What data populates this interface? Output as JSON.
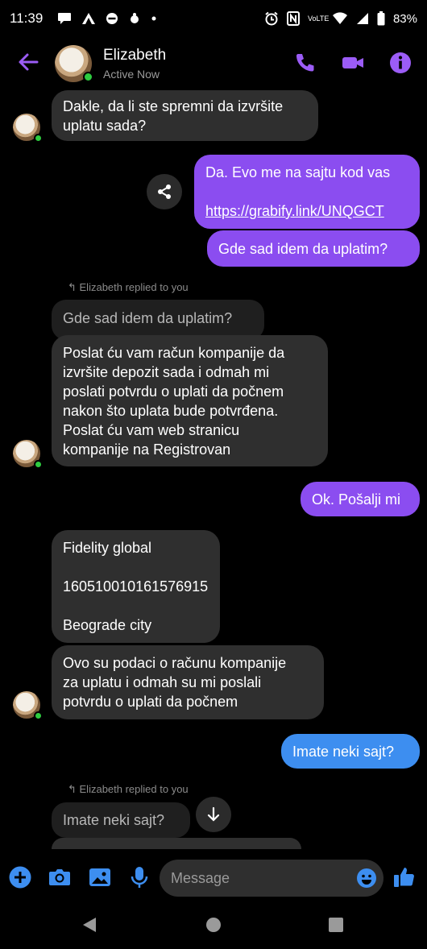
{
  "status_bar": {
    "time": "11:39",
    "battery": "83%",
    "volte": "VoLTE"
  },
  "header": {
    "contact_name": "Elizabeth",
    "contact_status": "Active Now"
  },
  "messages": {
    "m1": "Dakle, da li ste spremni da izvršite\nuplatu sada?",
    "m2_text": "Da. Evo me na sajtu kod vas",
    "m2_link": "https://grabify.link/UNQGCT",
    "m3": "Gde sad idem da uplatim?",
    "reply_note_1": "Elizabeth replied to you",
    "quoted_1": "Gde sad idem da uplatim?",
    "m4": "Poslat ću vam račun kompanije da\nizvršite depozit sada i odmah mi\nposlati potvrdu o uplati da počnem\nnakon što uplata bude potvrđena.\nPoslat ću vam web stranicu\nkompanije na Registrovan",
    "m5": "Ok. Pošalji mi",
    "m6": "Fidelity global\n\n160510010161576915\n\nBeograde city",
    "m7": "Ovo su podaci o računu kompanije\nza uplatu i odmah su mi poslali\npotvrdu o uplati da počnem",
    "m8": "Imate neki sajt?",
    "reply_note_2": "Elizabeth replied to you",
    "quoted_2": "Imate neki sajt?"
  },
  "composer": {
    "placeholder": "Message"
  },
  "colors": {
    "accent_purple": "#8b4df0",
    "accent_blue": "#3d8ef0",
    "incoming_bubble": "#2f2f2f",
    "online_green": "#2ecc40"
  }
}
